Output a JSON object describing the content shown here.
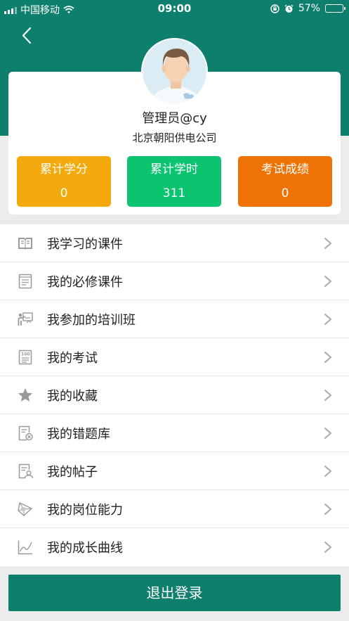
{
  "status_bar": {
    "carrier": "中国移动",
    "time": "09:00",
    "battery": "57%",
    "battery_level": 0.57
  },
  "profile": {
    "name": "管理员@cy",
    "company": "北京朝阳供电公司"
  },
  "stats": [
    {
      "label": "累计学分",
      "value": "0",
      "color": "#f4aa0d"
    },
    {
      "label": "累计学时",
      "value": "311",
      "color": "#0bc46f"
    },
    {
      "label": "考试成绩",
      "value": "0",
      "color": "#ef7206"
    }
  ],
  "menu": [
    {
      "label": "我学习的课件",
      "icon": "open-book-icon"
    },
    {
      "label": "我的必修课件",
      "icon": "document-icon"
    },
    {
      "label": "我参加的培训班",
      "icon": "training-class-icon"
    },
    {
      "label": "我的考试",
      "icon": "exam-paper-icon"
    },
    {
      "label": "我的收藏",
      "icon": "star-icon"
    },
    {
      "label": "我的错题库",
      "icon": "wrong-question-icon"
    },
    {
      "label": "我的帖子",
      "icon": "post-icon"
    },
    {
      "label": "我的岗位能力",
      "icon": "radar-chart-icon"
    },
    {
      "label": "我的成长曲线",
      "icon": "line-chart-icon"
    }
  ],
  "logout_label": "退出登录",
  "colors": {
    "brand": "#0f7f6d",
    "icon_gray": "#9a9a9a"
  }
}
